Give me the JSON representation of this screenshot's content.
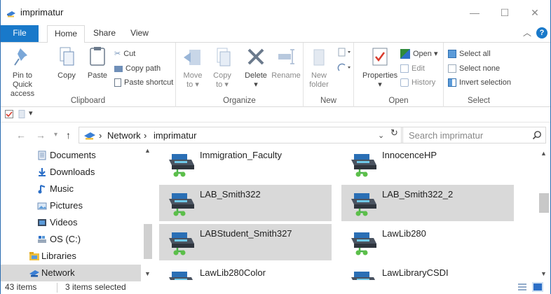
{
  "window": {
    "title": "imprimatur"
  },
  "tabs": {
    "file": "File",
    "home": "Home",
    "share": "Share",
    "view": "View"
  },
  "ribbon": {
    "clipboard": {
      "label": "Clipboard",
      "pin_line1": "Pin to Quick",
      "pin_line2": "access",
      "copy": "Copy",
      "paste": "Paste",
      "cut": "Cut",
      "copy_path": "Copy path",
      "paste_shortcut": "Paste shortcut"
    },
    "organize": {
      "label": "Organize",
      "move_line1": "Move",
      "move_line2": "to ▾",
      "copy_line1": "Copy",
      "copy_line2": "to ▾",
      "delete": "Delete",
      "delete_arrow": "▾",
      "rename": "Rename"
    },
    "new": {
      "label": "New",
      "folder_line1": "New",
      "folder_line2": "folder"
    },
    "open": {
      "label": "Open",
      "properties": "Properties",
      "properties_arrow": "▾",
      "open": "Open ▾",
      "edit": "Edit",
      "history": "History"
    },
    "select": {
      "label": "Select",
      "select_all": "Select all",
      "select_none": "Select none",
      "invert": "Invert selection"
    }
  },
  "address": {
    "crumbs": [
      "Network",
      "imprimatur"
    ],
    "separator": "›",
    "search_placeholder": "Search imprimatur"
  },
  "nav": {
    "items": [
      {
        "label": "Documents",
        "icon": "documents-icon"
      },
      {
        "label": "Downloads",
        "icon": "downloads-icon"
      },
      {
        "label": "Music",
        "icon": "music-icon"
      },
      {
        "label": "Pictures",
        "icon": "pictures-icon"
      },
      {
        "label": "Videos",
        "icon": "videos-icon"
      },
      {
        "label": "OS (C:)",
        "icon": "drive-icon"
      },
      {
        "label": "Libraries",
        "icon": "libraries-icon"
      },
      {
        "label": "Network",
        "icon": "network-icon",
        "selected": true
      }
    ]
  },
  "content": {
    "printers": [
      {
        "name": "Immigration_Faculty",
        "selected": false
      },
      {
        "name": "InnocenceHP",
        "selected": false
      },
      {
        "name": "LAB_Smith322",
        "selected": true
      },
      {
        "name": "LAB_Smith322_2",
        "selected": true
      },
      {
        "name": "LABStudent_Smith327",
        "selected": true
      },
      {
        "name": "LawLib280",
        "selected": false
      },
      {
        "name": "LawLib280Color",
        "selected": false
      },
      {
        "name": "LawLibraryCSDI",
        "selected": false
      }
    ]
  },
  "status": {
    "items_count": "43 items",
    "selected": "3 items selected"
  },
  "colors": {
    "accent": "#1979ca",
    "selection": "#d9d9d9"
  }
}
